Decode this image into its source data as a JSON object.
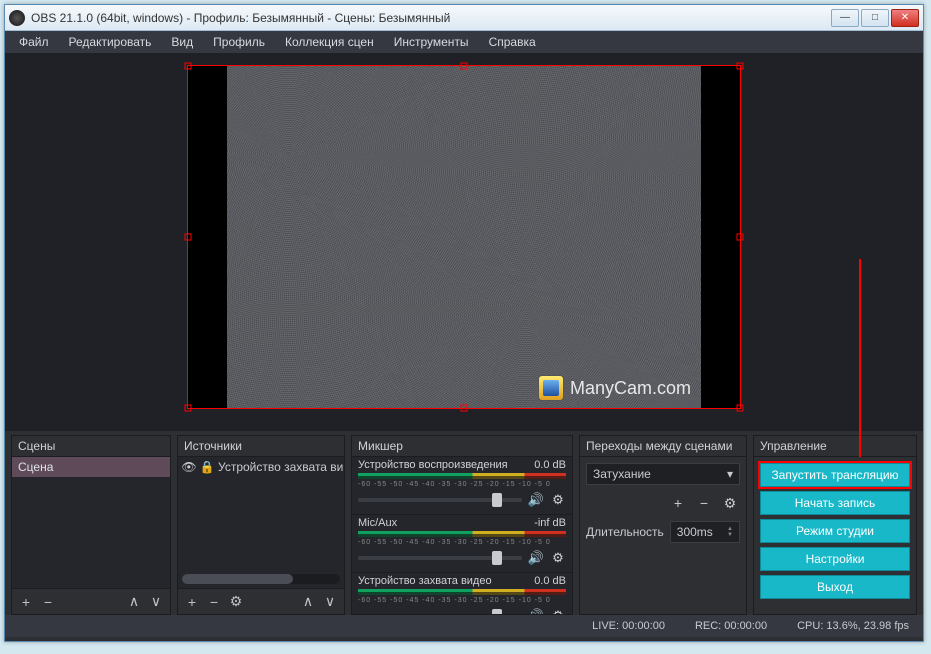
{
  "window": {
    "title": "OBS 21.1.0 (64bit, windows) - Профиль: Безымянный - Сцены: Безымянный"
  },
  "menu": {
    "file": "Файл",
    "edit": "Редактировать",
    "view": "Вид",
    "profile": "Профиль",
    "scene_col": "Коллекция сцен",
    "tools": "Инструменты",
    "help": "Справка"
  },
  "preview": {
    "watermark": "ManyCam.com"
  },
  "panels": {
    "scenes": {
      "title": "Сцены",
      "items": [
        "Сцена"
      ]
    },
    "sources": {
      "title": "Источники",
      "items": [
        "Устройство захвата ви"
      ]
    },
    "mixer": {
      "title": "Микшер",
      "ticks": "-60 -55 -50 -45 -40 -35 -30 -25 -20 -15 -10 -5  0",
      "channels": [
        {
          "name": "Устройство воспроизведения",
          "level": "0.0 dB",
          "thumb": 85
        },
        {
          "name": "Mic/Aux",
          "level": "-inf dB",
          "thumb": 85
        },
        {
          "name": "Устройство захвата видео",
          "level": "0.0 dB",
          "thumb": 85
        }
      ]
    },
    "transitions": {
      "title": "Переходы между сценами",
      "mode": "Затухание",
      "duration_label": "Длительность",
      "duration": "300ms"
    },
    "controls": {
      "title": "Управление",
      "buttons": {
        "stream": "Запустить трансляцию",
        "record": "Начать запись",
        "studio": "Режим студии",
        "settings": "Настройки",
        "exit": "Выход"
      }
    }
  },
  "status": {
    "live": "LIVE: 00:00:00",
    "rec": "REC: 00:00:00",
    "cpu": "CPU: 13.6%, 23.98 fps"
  }
}
